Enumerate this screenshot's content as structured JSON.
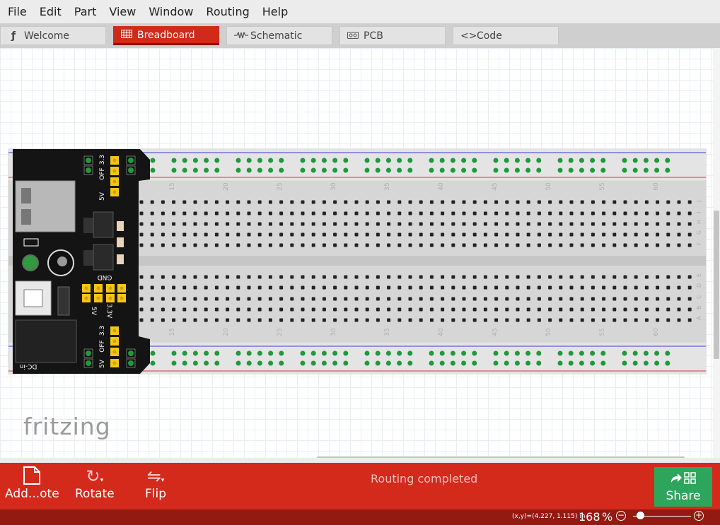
{
  "menu": [
    "File",
    "Edit",
    "Part",
    "View",
    "Window",
    "Routing",
    "Help"
  ],
  "tabs": [
    {
      "label": "Welcome",
      "icon": "fritzing-f-icon"
    },
    {
      "label": "Breadboard",
      "icon": "breadboard-icon"
    },
    {
      "label": "Schematic",
      "icon": "resistor-icon"
    },
    {
      "label": "PCB",
      "icon": "pcb-icon"
    },
    {
      "label": "Code",
      "icon": "code-icon"
    }
  ],
  "active_tab": "Breadboard",
  "canvas": {
    "logo_text": "fritzing",
    "breadboard": {
      "column_numbers": [
        "15",
        "20",
        "25",
        "30",
        "35",
        "40",
        "45",
        "50",
        "55",
        "60"
      ],
      "row_letters_top": [
        "J",
        "I",
        "H",
        "G",
        "F"
      ],
      "row_letters_bottom": [
        "E",
        "D",
        "C",
        "B",
        "A"
      ]
    },
    "power_module": {
      "labels": [
        "OFF",
        "3.3",
        "5V",
        "GND",
        "5V",
        "3.3V",
        "3.3",
        "OFF",
        "5V",
        "DC-in"
      ]
    }
  },
  "toolbar": {
    "add_note_label": "Add...ote",
    "rotate_label": "Rotate",
    "flip_label": "Flip",
    "status_text": "Routing completed",
    "share_label": "Share"
  },
  "statusbar": {
    "coords_text": "(x,y)=(4.227, 1.115) in",
    "zoom_value": "168",
    "zoom_unit": "%",
    "zoom_slider_level": 0.07
  },
  "colors": {
    "accent": "#d32a1c",
    "status_bar": "#921a10",
    "share_button": "#2ea55c",
    "pin_green": "#1e9a3a",
    "jumper_yellow": "#f5c518"
  }
}
